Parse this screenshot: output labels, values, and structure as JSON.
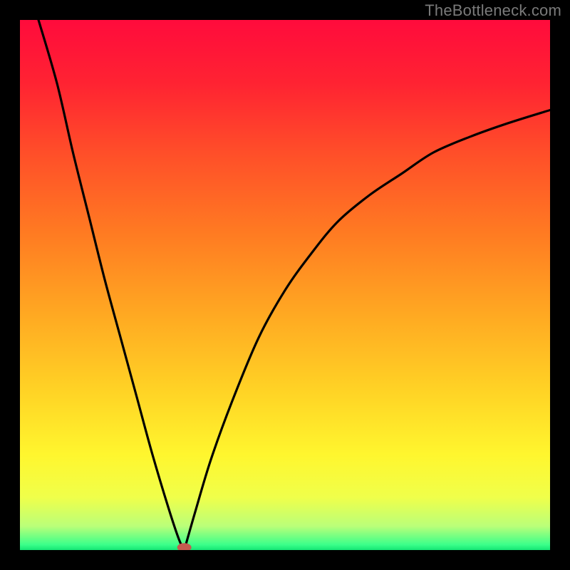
{
  "watermark": "TheBottleneck.com",
  "gradient": {
    "stops": [
      {
        "offset": 0.0,
        "color": "#ff0b3c"
      },
      {
        "offset": 0.12,
        "color": "#ff2332"
      },
      {
        "offset": 0.25,
        "color": "#ff4e29"
      },
      {
        "offset": 0.4,
        "color": "#ff7a22"
      },
      {
        "offset": 0.55,
        "color": "#ffa722"
      },
      {
        "offset": 0.7,
        "color": "#ffd325"
      },
      {
        "offset": 0.82,
        "color": "#fff62e"
      },
      {
        "offset": 0.9,
        "color": "#f0ff4a"
      },
      {
        "offset": 0.955,
        "color": "#baff79"
      },
      {
        "offset": 0.99,
        "color": "#3bff8a"
      },
      {
        "offset": 1.0,
        "color": "#15e574"
      }
    ]
  },
  "chart_data": {
    "type": "line",
    "title": "",
    "xlabel": "",
    "ylabel": "",
    "xlim": [
      0,
      100
    ],
    "ylim": [
      0,
      100
    ],
    "vertex": {
      "x": 31,
      "y": 0
    },
    "marker": {
      "x": 31,
      "y": 0.5,
      "color": "#c55b4f"
    },
    "series": [
      {
        "name": "left-branch",
        "x": [
          3.5,
          7,
          10,
          13,
          16,
          19,
          22,
          25,
          28,
          30,
          31
        ],
        "values": [
          100,
          88,
          75,
          63,
          51,
          40,
          29,
          18,
          8,
          2,
          0
        ]
      },
      {
        "name": "right-branch",
        "x": [
          31,
          33,
          36,
          40,
          45,
          50,
          55,
          60,
          66,
          72,
          78,
          85,
          92,
          100
        ],
        "values": [
          0,
          7,
          17,
          28,
          40,
          49,
          56,
          62,
          67,
          71,
          75,
          78,
          80.5,
          83
        ]
      }
    ]
  }
}
